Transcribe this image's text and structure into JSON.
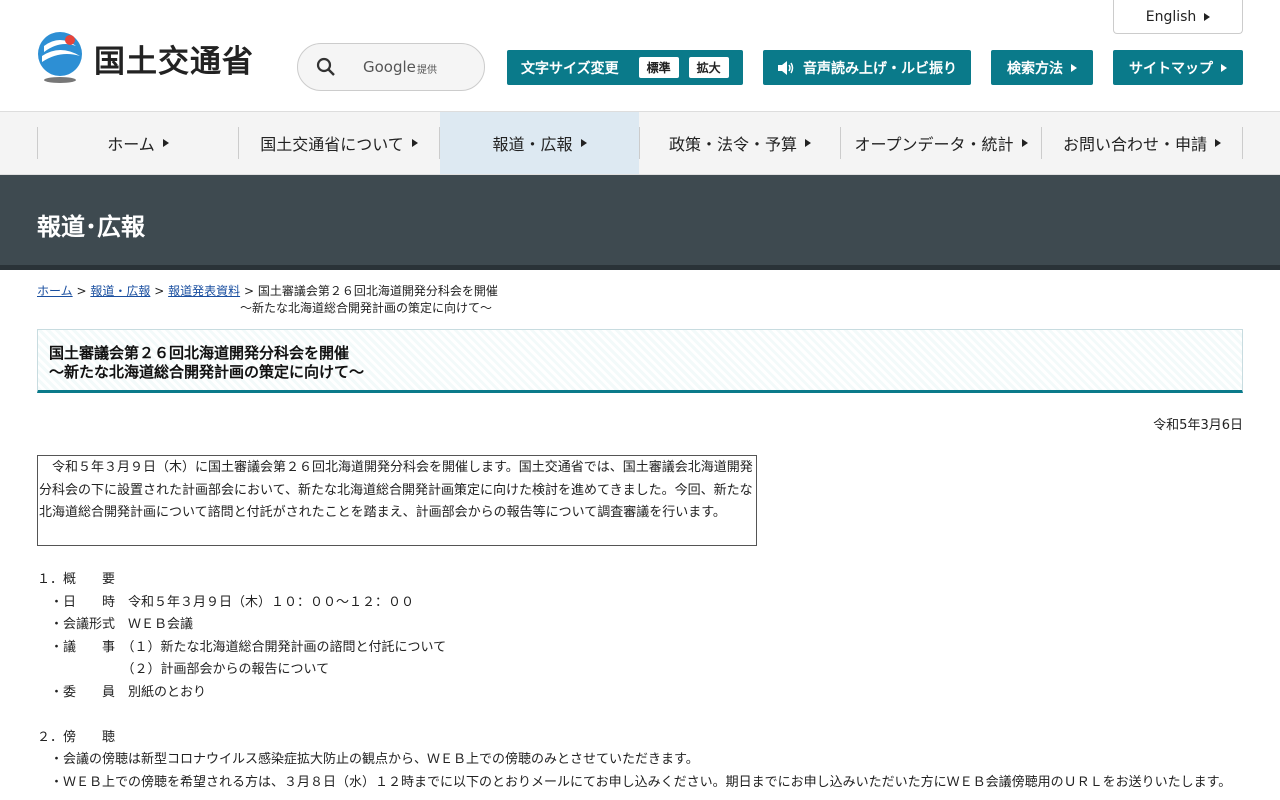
{
  "header": {
    "logo_text": "国土交通省",
    "search": {
      "google_label": "Google",
      "provided_label": "提供"
    },
    "english_label": "English",
    "fontsize": {
      "label": "文字サイズ変更",
      "standard": "標準",
      "large": "拡大"
    },
    "voice_label": "音声読み上げ・ルビ振り",
    "search_method_label": "検索方法",
    "sitemap_label": "サイトマップ"
  },
  "nav": [
    {
      "label": "ホーム"
    },
    {
      "label": "国土交通省について"
    },
    {
      "label": "報道・広報"
    },
    {
      "label": "政策・法令・予算"
    },
    {
      "label": "オープンデータ・統計"
    },
    {
      "label": "お問い合わせ・申請"
    }
  ],
  "banner_title": "報道･広報",
  "breadcrumb": {
    "home": "ホーム",
    "press": "報道・広報",
    "releases": "報道発表資料",
    "current_line1": "国土審議会第２６回北海道開発分科会を開催",
    "current_line2": "～新たな北海道総合開発計画の策定に向けて～",
    "sep": ">"
  },
  "article": {
    "title_line1": "国土審議会第２６回北海道開発分科会を開催",
    "title_line2": "～新たな北海道総合開発計画の策定に向けて～",
    "date": "令和5年3月6日",
    "intro": "　令和５年３月９日（木）に国土審議会第２６回北海道開発分科会を開催します。国土交通省では、国土審議会北海道開発分科会の下に設置された計画部会において、新たな北海道総合開発計画策定に向けた検討を進めてきました。今回、新たな北海道総合開発計画について諮問と付託がされたことを踏まえ、計画部会からの報告等について調査審議を行います。",
    "body": "１．概　　要\n　・日　　時　令和５年３月９日（木）１０：００～１２：００\n　・会議形式　ＷＥＢ会議\n　・議　　事　（１）新たな北海道総合開発計画の諮問と付託について\n　　　　　　　（２）計画部会からの報告について\n　・委　　員　別紙のとおり\n\n２．傍　　聴\n　・会議の傍聴は新型コロナウイルス感染症拡大防止の観点から、ＷＥＢ上での傍聴のみとさせていただきます。\n　・ＷＥＢ上での傍聴を希望される方は、３月８日（水）１２時までに以下のとおりメールにてお申し込みください。期日までにお申し込みいただいた方にＷＥＢ会議傍聴用のＵＲＬをお送りいたします。"
  },
  "colors": {
    "accent": "#0a7a8a",
    "banner": "#3e4a50",
    "nav_active": "#dde9f2",
    "link": "#1a4fa0"
  }
}
